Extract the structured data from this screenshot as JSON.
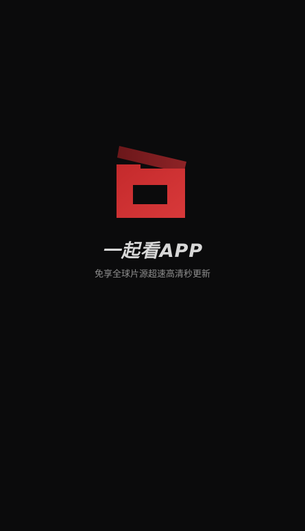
{
  "splash": {
    "app_name": "一起看APP",
    "tagline": "免享全球片源超速高清秒更新"
  },
  "colors": {
    "background": "#0b0b0c",
    "logo_red": "#cc2f30",
    "logo_dark_red": "#7a1b1d",
    "title_text": "#d8d8d8",
    "tagline_text": "#8e8e8e"
  },
  "icons": {
    "logo": "clapperboard-icon"
  }
}
